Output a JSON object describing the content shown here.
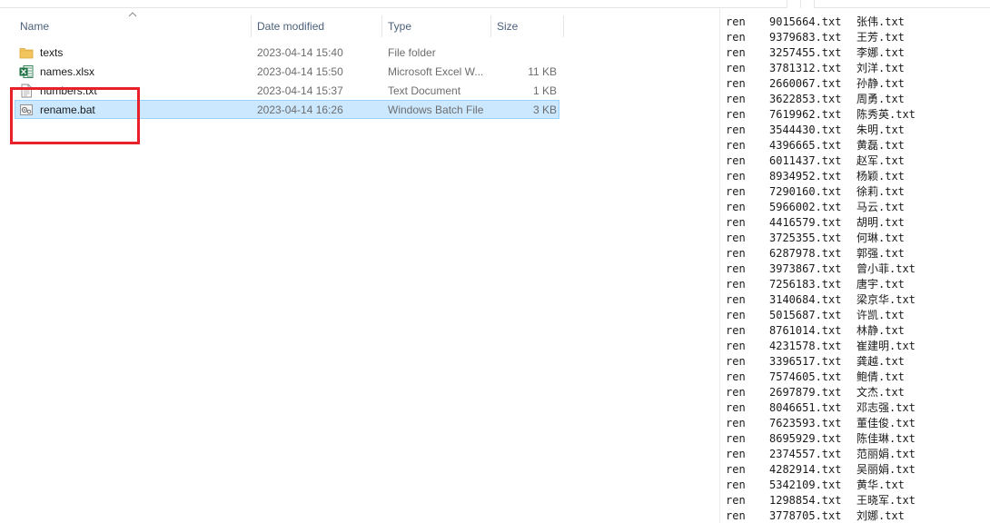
{
  "explorer": {
    "columns": {
      "name": "Name",
      "date": "Date modified",
      "type": "Type",
      "size": "Size"
    },
    "files": [
      {
        "name": "texts",
        "date": "2023-04-14 15:40",
        "type": "File folder",
        "size": "",
        "icon": "folder-icon",
        "selected": false
      },
      {
        "name": "names.xlsx",
        "date": "2023-04-14 15:50",
        "type": "Microsoft Excel W...",
        "size": "11 KB",
        "icon": "excel-file-icon",
        "selected": false
      },
      {
        "name": "numbers.txt",
        "date": "2023-04-14 15:37",
        "type": "Text Document",
        "size": "1 KB",
        "icon": "text-file-icon",
        "selected": false
      },
      {
        "name": "rename.bat",
        "date": "2023-04-14 16:26",
        "type": "Windows Batch File",
        "size": "3 KB",
        "icon": "batch-file-icon",
        "selected": true
      }
    ]
  },
  "colors": {
    "selection_bg": "#cce8ff",
    "selection_border": "#99d1ff",
    "annotation": "#e8202a",
    "header_text": "#4c607a",
    "folder": "#f2c55c",
    "excel": "#1f7244"
  },
  "code_lines": [
    {
      "cmd": "ren",
      "src": "9015664.txt",
      "dst": "张伟.txt"
    },
    {
      "cmd": "ren",
      "src": "9379683.txt",
      "dst": "王芳.txt"
    },
    {
      "cmd": "ren",
      "src": "3257455.txt",
      "dst": "李娜.txt"
    },
    {
      "cmd": "ren",
      "src": "3781312.txt",
      "dst": "刘洋.txt"
    },
    {
      "cmd": "ren",
      "src": "2660067.txt",
      "dst": "孙静.txt"
    },
    {
      "cmd": "ren",
      "src": "3622853.txt",
      "dst": "周勇.txt"
    },
    {
      "cmd": "ren",
      "src": "7619962.txt",
      "dst": "陈秀英.txt"
    },
    {
      "cmd": "ren",
      "src": "3544430.txt",
      "dst": "朱明.txt"
    },
    {
      "cmd": "ren",
      "src": "4396665.txt",
      "dst": "黄磊.txt"
    },
    {
      "cmd": "ren",
      "src": "6011437.txt",
      "dst": "赵军.txt"
    },
    {
      "cmd": "ren",
      "src": "8934952.txt",
      "dst": "杨颖.txt"
    },
    {
      "cmd": "ren",
      "src": "7290160.txt",
      "dst": "徐莉.txt"
    },
    {
      "cmd": "ren",
      "src": "5966002.txt",
      "dst": "马云.txt"
    },
    {
      "cmd": "ren",
      "src": "4416579.txt",
      "dst": "胡明.txt"
    },
    {
      "cmd": "ren",
      "src": "3725355.txt",
      "dst": "何琳.txt"
    },
    {
      "cmd": "ren",
      "src": "6287978.txt",
      "dst": "郭强.txt"
    },
    {
      "cmd": "ren",
      "src": "3973867.txt",
      "dst": "曾小菲.txt"
    },
    {
      "cmd": "ren",
      "src": "7256183.txt",
      "dst": "唐宇.txt"
    },
    {
      "cmd": "ren",
      "src": "3140684.txt",
      "dst": "梁京华.txt"
    },
    {
      "cmd": "ren",
      "src": "5015687.txt",
      "dst": "许凯.txt"
    },
    {
      "cmd": "ren",
      "src": "8761014.txt",
      "dst": "林静.txt"
    },
    {
      "cmd": "ren",
      "src": "4231578.txt",
      "dst": "崔建明.txt"
    },
    {
      "cmd": "ren",
      "src": "3396517.txt",
      "dst": "龚越.txt"
    },
    {
      "cmd": "ren",
      "src": "7574605.txt",
      "dst": "鲍倩.txt"
    },
    {
      "cmd": "ren",
      "src": "2697879.txt",
      "dst": "文杰.txt"
    },
    {
      "cmd": "ren",
      "src": "8046651.txt",
      "dst": "邓志强.txt"
    },
    {
      "cmd": "ren",
      "src": "7623593.txt",
      "dst": "董佳俊.txt"
    },
    {
      "cmd": "ren",
      "src": "8695929.txt",
      "dst": "陈佳琳.txt"
    },
    {
      "cmd": "ren",
      "src": "2374557.txt",
      "dst": "范丽娟.txt"
    },
    {
      "cmd": "ren",
      "src": "4282914.txt",
      "dst": "吴丽娟.txt"
    },
    {
      "cmd": "ren",
      "src": "5342109.txt",
      "dst": "黄华.txt"
    },
    {
      "cmd": "ren",
      "src": "1298854.txt",
      "dst": "王晓军.txt"
    },
    {
      "cmd": "ren",
      "src": "3778705.txt",
      "dst": "刘娜.txt"
    }
  ]
}
